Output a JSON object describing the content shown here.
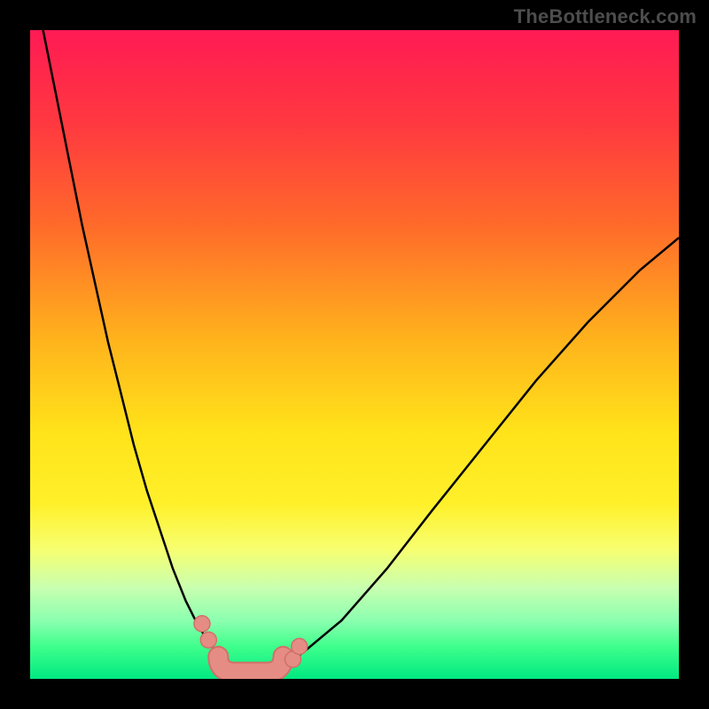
{
  "watermark": "TheBottleneck.com",
  "chart_data": {
    "type": "line",
    "title": "",
    "xlabel": "",
    "ylabel": "",
    "xlim": [
      0,
      100
    ],
    "ylim": [
      0,
      100
    ],
    "grid": false,
    "legend": false,
    "series": [
      {
        "name": "curve",
        "x": [
          2,
          4,
          6,
          8,
          10,
          12,
          14,
          16,
          18,
          20,
          22,
          24,
          26,
          28,
          30,
          32,
          34,
          36,
          38,
          42,
          48,
          55,
          62,
          70,
          78,
          86,
          94,
          100
        ],
        "y": [
          100,
          90,
          80,
          70,
          61,
          52,
          44,
          36,
          29,
          23,
          17,
          12,
          8,
          5,
          3,
          1.5,
          0.8,
          0.8,
          1.5,
          4,
          9,
          17,
          26,
          36,
          46,
          55,
          63,
          68
        ]
      }
    ],
    "points": [
      {
        "name": "left-upper-dot",
        "x": 26.5,
        "y": 8.5
      },
      {
        "name": "left-lower-dot",
        "x": 27.5,
        "y": 6.0
      },
      {
        "name": "right-lower-dot",
        "x": 40.5,
        "y": 3.0
      },
      {
        "name": "right-upper-dot",
        "x": 41.5,
        "y": 5.0
      }
    ],
    "bottom_band": {
      "x_start": 29,
      "x_end": 39,
      "y": 1.0
    },
    "background_gradient": {
      "top": "#ff1a54",
      "upper_mid": "#ff6a2a",
      "mid": "#ffe31a",
      "lower_mid": "#c8ffb0",
      "bottom": "#00e981"
    }
  }
}
